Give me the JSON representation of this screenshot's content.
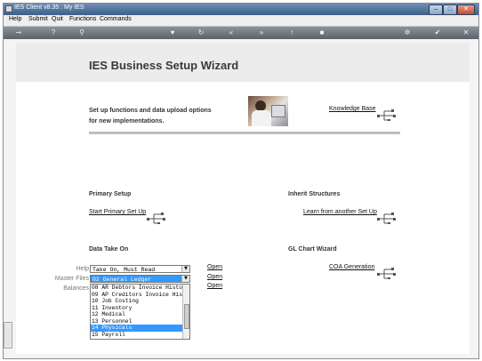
{
  "window": {
    "title": "IES Client v8.35 : My IES"
  },
  "menu": [
    "Help",
    "Submit",
    "Quit",
    "Functions",
    "Commands"
  ],
  "toolbar": [
    {
      "icon": "key-icon",
      "glyph": "⊸"
    },
    {
      "icon": "help-icon",
      "glyph": "?"
    },
    {
      "icon": "search-icon",
      "glyph": "⚲"
    },
    {
      "icon": "heart-icon",
      "glyph": "♥"
    },
    {
      "icon": "refresh-icon",
      "glyph": "↻"
    },
    {
      "icon": "rewind-icon",
      "glyph": "«"
    },
    {
      "icon": "forward-icon",
      "glyph": "»"
    },
    {
      "icon": "up-icon",
      "glyph": "↑"
    },
    {
      "icon": "stop-icon",
      "glyph": "■"
    },
    {
      "icon": "gear-icon",
      "glyph": "✲"
    },
    {
      "icon": "check-icon",
      "glyph": "✔"
    },
    {
      "icon": "close-icon",
      "glyph": "✕"
    }
  ],
  "wizard": {
    "title": "IES Business Setup Wizard",
    "intro_line1": "Set up functions and data upload options",
    "intro_line2": "for new implementations.",
    "knowledge_base": "Knowledge Base"
  },
  "sections": {
    "primary_setup": {
      "title": "Primary Setup",
      "link": "Start Primary Set Up"
    },
    "inherit": {
      "title": "Inherit Structures",
      "link": "Learn from another Set Up"
    },
    "data_take_on": {
      "title": "Data Take On"
    },
    "gl_chart": {
      "title": "GL Chart Wizard",
      "link": "COA Generation"
    }
  },
  "fields": {
    "help": {
      "label": "Help",
      "value": "Take On, Must Read",
      "action": "Open"
    },
    "master_files": {
      "label": "Master Files",
      "value": "02 General Ledger",
      "action": "Open"
    },
    "balances": {
      "label": "Balances",
      "action": "Open"
    }
  },
  "dropdown_options": [
    "08 AR Debtors Invoice Histor",
    "09 AP Creditors Invoice Hist",
    "10 Job Costing",
    "11 Inventory",
    "12 Medical",
    "13 Personnel",
    "14 Physicals",
    "15 Payroll"
  ],
  "selected_option_index": 6,
  "colors": {
    "selection": "#3399ff",
    "titlebar": "#3c5f89",
    "toolbar": "#5a626a"
  }
}
